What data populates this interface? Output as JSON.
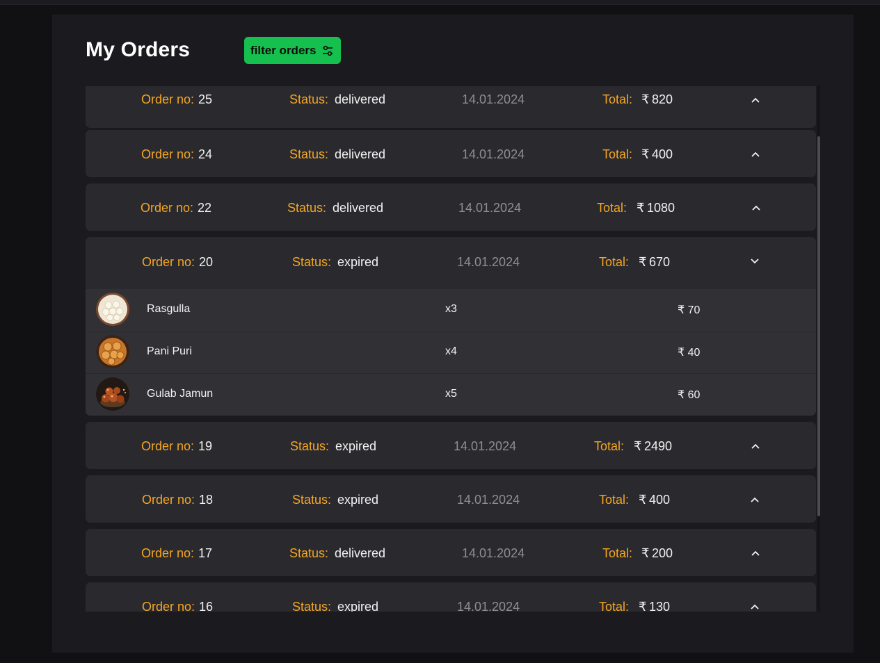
{
  "header": {
    "title": "My Orders",
    "filter_label": "filter orders",
    "accent": "#15c04e"
  },
  "labels": {
    "order_no": "Order no:",
    "status": "Status:",
    "total": "Total:",
    "currency": "₹"
  },
  "orders": [
    {
      "no": "25",
      "status": "delivered",
      "date": "14.01.2024",
      "total": "820",
      "expanded": false
    },
    {
      "no": "24",
      "status": "delivered",
      "date": "14.01.2024",
      "total": "400",
      "expanded": false
    },
    {
      "no": "22",
      "status": "delivered",
      "date": "14.01.2024",
      "total": "1080",
      "expanded": false
    },
    {
      "no": "20",
      "status": "expired",
      "date": "14.01.2024",
      "total": "670",
      "expanded": true,
      "items": [
        {
          "name": "Rasgulla",
          "qty": "x3",
          "price": "₹ 70",
          "icon": "rasgulla-photo"
        },
        {
          "name": "Pani Puri",
          "qty": "x4",
          "price": "₹ 40",
          "icon": "pani-puri-photo"
        },
        {
          "name": "Gulab Jamun",
          "qty": "x5",
          "price": "₹ 60",
          "icon": "gulab-jamun-photo"
        }
      ]
    },
    {
      "no": "19",
      "status": "expired",
      "date": "14.01.2024",
      "total": "2490",
      "expanded": false
    },
    {
      "no": "18",
      "status": "expired",
      "date": "14.01.2024",
      "total": "400",
      "expanded": false
    },
    {
      "no": "17",
      "status": "delivered",
      "date": "14.01.2024",
      "total": "200",
      "expanded": false
    },
    {
      "no": "16",
      "status": "expired",
      "date": "14.01.2024",
      "total": "130",
      "expanded": false
    }
  ],
  "colors": {
    "label": "#f5a623",
    "value": "#f2f2f2",
    "date": "#8d8d93",
    "card": "#2a2a2e",
    "panel": "#1b1b1f"
  }
}
